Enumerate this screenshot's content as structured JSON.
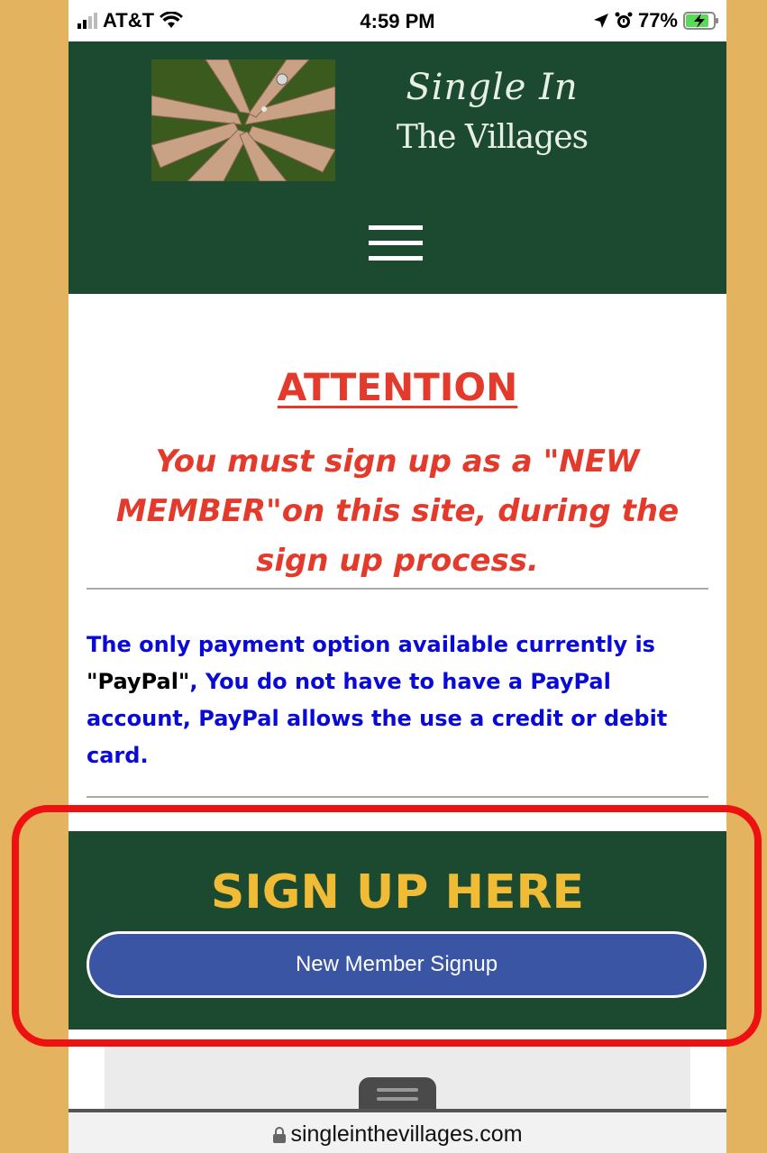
{
  "status_bar": {
    "carrier": "AT&T",
    "time": "4:59 PM",
    "battery_percent": "77%"
  },
  "header": {
    "logo_line1": "Single In",
    "logo_line2": "The Villages",
    "logo_image": "hands-together-photo"
  },
  "content": {
    "attention_title": "ATTENTION",
    "warning_text": "You must sign up as a \"NEW MEMBER\"on this site, during the sign up process.",
    "payment_note_part1": "The only payment option available currently is ",
    "payment_note_paypal": "\"PayPal\"",
    "payment_note_part2": ", You do not have to have a PayPal account, PayPal allows the use a credit or debit card."
  },
  "signup": {
    "title": "SIGN UP HERE",
    "button_label": "New Member Signup"
  },
  "browser": {
    "url": "singleinthevillages.com"
  },
  "colors": {
    "page_background": "#e4b35f",
    "header_green": "#1c4a30",
    "attention_red": "#e33a2b",
    "note_blue": "#0a0ad8",
    "signup_gold": "#f0bc36",
    "button_blue": "#3955a3",
    "highlight_red": "#ee1111"
  }
}
